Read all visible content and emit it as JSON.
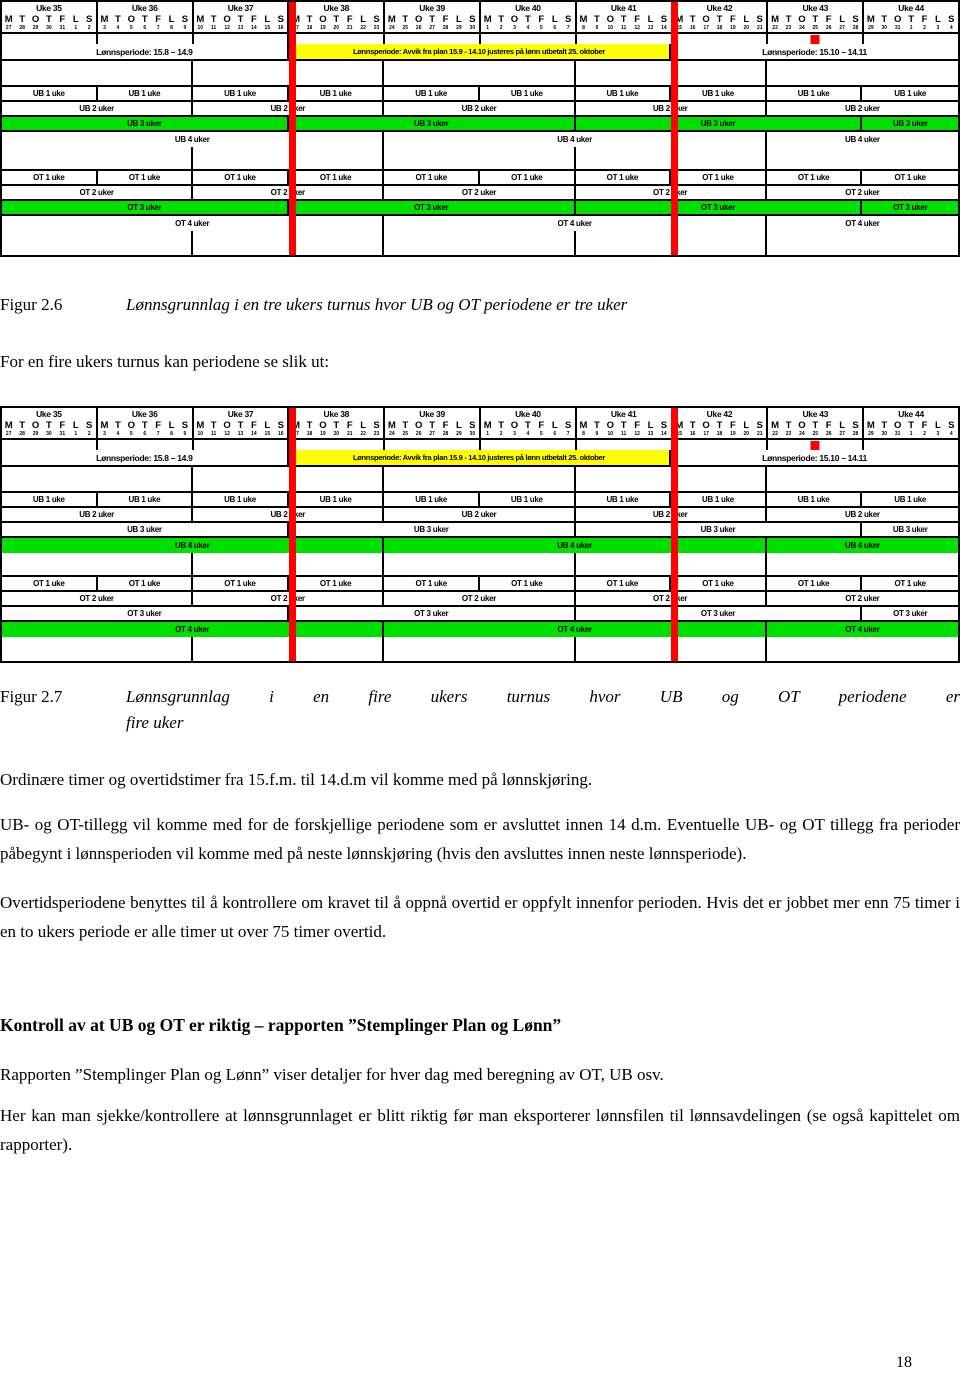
{
  "document": {
    "page_number": "18",
    "language": "no"
  },
  "weeks": [
    {
      "name": "Uke 35",
      "days": [
        "M",
        "T",
        "O",
        "T",
        "F",
        "L",
        "S"
      ],
      "nums": [
        "27",
        "28",
        "29",
        "30",
        "31",
        "1",
        "2"
      ]
    },
    {
      "name": "Uke 36",
      "days": [
        "M",
        "T",
        "O",
        "T",
        "F",
        "L",
        "S"
      ],
      "nums": [
        "3",
        "4",
        "5",
        "6",
        "7",
        "8",
        "9"
      ]
    },
    {
      "name": "Uke 37",
      "days": [
        "M",
        "T",
        "O",
        "T",
        "F",
        "L",
        "S"
      ],
      "nums": [
        "10",
        "11",
        "12",
        "13",
        "14",
        "15",
        "16"
      ]
    },
    {
      "name": "Uke 38",
      "days": [
        "M",
        "T",
        "O",
        "T",
        "F",
        "L",
        "S"
      ],
      "nums": [
        "17",
        "18",
        "19",
        "20",
        "21",
        "22",
        "23"
      ]
    },
    {
      "name": "Uke 39",
      "days": [
        "M",
        "T",
        "O",
        "T",
        "F",
        "L",
        "S"
      ],
      "nums": [
        "24",
        "25",
        "26",
        "27",
        "28",
        "29",
        "30"
      ]
    },
    {
      "name": "Uke 40",
      "days": [
        "M",
        "T",
        "O",
        "T",
        "F",
        "L",
        "S"
      ],
      "nums": [
        "1",
        "2",
        "3",
        "4",
        "5",
        "6",
        "7"
      ]
    },
    {
      "name": "Uke 41",
      "days": [
        "M",
        "T",
        "O",
        "T",
        "F",
        "L",
        "S"
      ],
      "nums": [
        "8",
        "9",
        "10",
        "11",
        "12",
        "13",
        "14"
      ]
    },
    {
      "name": "Uke 42",
      "days": [
        "M",
        "T",
        "O",
        "T",
        "F",
        "L",
        "S"
      ],
      "nums": [
        "15",
        "16",
        "17",
        "18",
        "19",
        "20",
        "21"
      ]
    },
    {
      "name": "Uke 43",
      "days": [
        "M",
        "T",
        "O",
        "T",
        "F",
        "L",
        "S"
      ],
      "nums": [
        "22",
        "23",
        "24",
        "25",
        "26",
        "27",
        "28"
      ]
    },
    {
      "name": "Uke 44",
      "days": [
        "M",
        "T",
        "O",
        "T",
        "F",
        "L",
        "S"
      ],
      "nums": [
        "29",
        "30",
        "31",
        "1",
        "2",
        "3",
        "4"
      ]
    }
  ],
  "marker": {
    "week_index": 8,
    "day_index": 3,
    "color": "#ff0000"
  },
  "periods": [
    {
      "label": "Lønnsperiode: 15.8 – 14.9",
      "highlight": false
    },
    {
      "label": "Lønnsperiode: Avvik fra plan 15.9 - 14.10 justeres på lønn utbetalt 25. oktober",
      "highlight": true
    },
    {
      "label": "Lønnsperiode: 15.10 – 14.11",
      "highlight": false
    }
  ],
  "labels": {
    "ub1": "UB 1 uke",
    "ub2": "UB 2 uker",
    "ub3": "UB 3 uker",
    "ub4": "UB 4 uker",
    "ot1": "OT 1 uke",
    "ot2": "OT 2 uker",
    "ot3": "OT 3 uker",
    "ot4": "OT 4 uker"
  },
  "colors": {
    "highlight_period": "#ffff00",
    "highlight_bar": "#00e000",
    "divider": "#ff0000",
    "grid": "#000000"
  },
  "figure_2_6": {
    "caption_label": "Figur 2.6",
    "caption_text": "Lønnsgrunnlag i en tre ukers turnus hvor UB og OT periodene er tre uker",
    "highlight_row": "ub3_ot3"
  },
  "figure_2_7": {
    "caption_label": "Figur 2.7",
    "caption_text": "Lønnsgrunnlag i en fire ukers turnus hvor UB og OT periodene er",
    "caption_text_cont": "fire uker",
    "highlight_row": "ub4_ot4"
  },
  "body": {
    "intro_fire_uker": "For en fire ukers turnus kan periodene se slik ut:",
    "para_1": "Ordinære timer og overtidstimer fra 15.f.m. til 14.d.m vil komme med på lønnskjøring.",
    "para_2": "UB- og OT-tillegg vil komme med for de forskjellige periodene som er avsluttet innen 14 d.m. Eventuelle UB- og OT tillegg fra perioder påbegynt i lønnsperioden vil komme med på neste lønnskjøring (hvis den avsluttes innen neste lønnsperiode).",
    "para_3": "Overtidsperiodene benyttes til å kontrollere om kravet til å oppnå overtid er oppfylt innenfor perioden. Hvis det er jobbet mer enn 75 timer i en to ukers periode er alle timer ut over 75 timer overtid.",
    "heading": "Kontroll av at UB og OT er riktig – rapporten ”Stemplinger Plan og Lønn”",
    "para_4": "Rapporten ”Stemplinger Plan og Lønn” viser detaljer for hver dag med beregning av OT, UB osv.",
    "para_5": "Her kan man sjekke/kontrollere at lønnsgrunnlaget er blitt riktig før man eksporterer lønnsfilen til lønnsavdelingen (se også kapittelet om rapporter)."
  }
}
